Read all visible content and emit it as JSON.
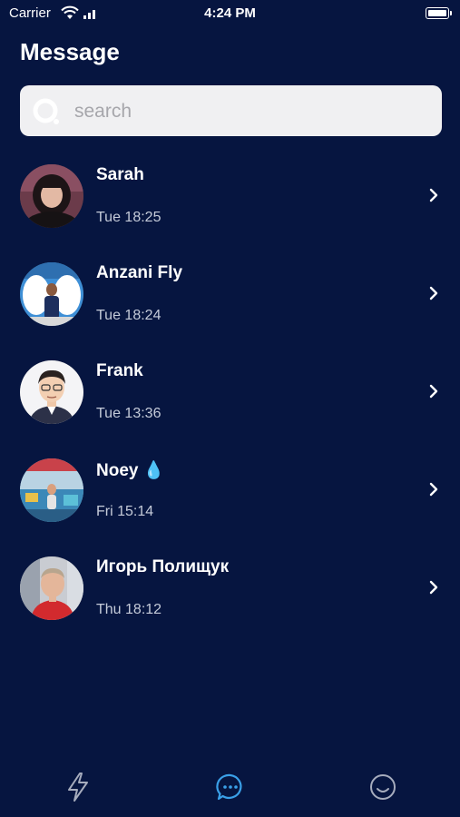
{
  "status_bar": {
    "carrier": "Carrier",
    "time": "4:24 PM"
  },
  "header": {
    "title": "Message"
  },
  "search": {
    "placeholder": "search",
    "value": ""
  },
  "conversations": [
    {
      "name": "Sarah",
      "time": "Tue 18:25"
    },
    {
      "name": "Anzani Fly",
      "time": "Tue 18:24"
    },
    {
      "name": "Frank",
      "time": "Tue 13:36"
    },
    {
      "name": "Noey 💧",
      "time": "Fri 15:14"
    },
    {
      "name": "Игорь Полищук",
      "time": "Thu 18:12"
    }
  ],
  "tab_bar": {
    "tabs": [
      {
        "icon": "lightning-icon",
        "active": false
      },
      {
        "icon": "chat-bubble-icon",
        "active": true
      },
      {
        "icon": "smiley-icon",
        "active": false
      }
    ]
  },
  "colors": {
    "background": "#061540",
    "active_tab": "#3aa0e8",
    "inactive_tab": "#a6acbd"
  }
}
